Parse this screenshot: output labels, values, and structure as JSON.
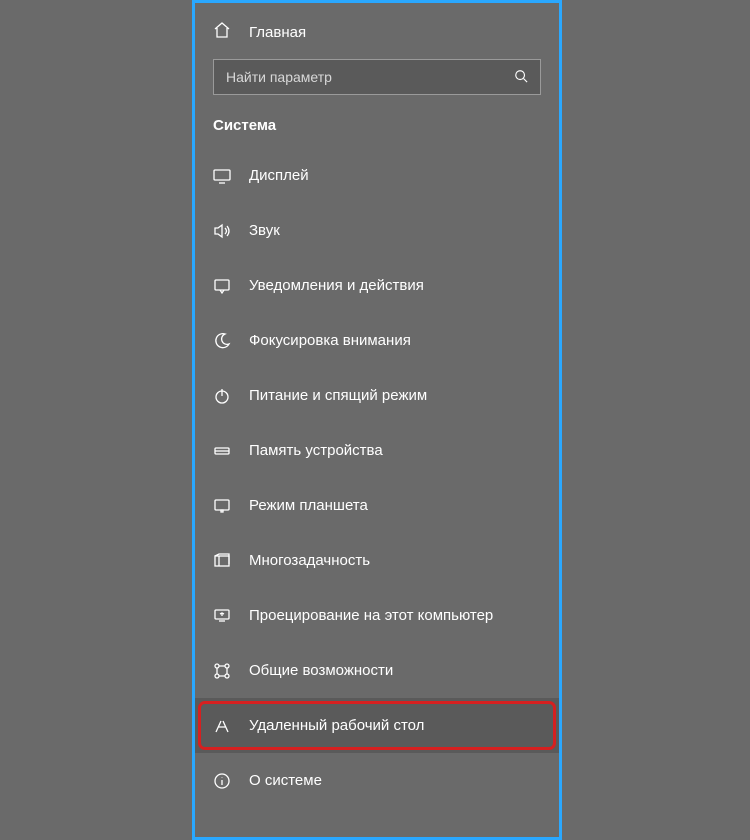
{
  "home": {
    "label": "Главная"
  },
  "search": {
    "placeholder": "Найти параметр"
  },
  "section_title": "Система",
  "nav": [
    {
      "id": "display",
      "label": "Дисплей",
      "icon": "monitor-icon"
    },
    {
      "id": "sound",
      "label": "Звук",
      "icon": "sound-icon"
    },
    {
      "id": "notifications",
      "label": "Уведомления и действия",
      "icon": "notification-icon"
    },
    {
      "id": "focus-assist",
      "label": "Фокусировка внимания",
      "icon": "moon-icon"
    },
    {
      "id": "power-sleep",
      "label": "Питание и спящий режим",
      "icon": "power-icon"
    },
    {
      "id": "storage",
      "label": "Память устройства",
      "icon": "storage-icon"
    },
    {
      "id": "tablet-mode",
      "label": "Режим планшета",
      "icon": "tablet-icon"
    },
    {
      "id": "multitasking",
      "label": "Многозадачность",
      "icon": "multitask-icon"
    },
    {
      "id": "projecting",
      "label": "Проецирование на этот компьютер",
      "icon": "project-icon"
    },
    {
      "id": "shared-exp",
      "label": "Общие возможности",
      "icon": "share-icon"
    },
    {
      "id": "remote-desktop",
      "label": "Удаленный рабочий стол",
      "icon": "remote-icon",
      "highlight": true
    },
    {
      "id": "about",
      "label": "О системе",
      "icon": "info-icon"
    }
  ]
}
